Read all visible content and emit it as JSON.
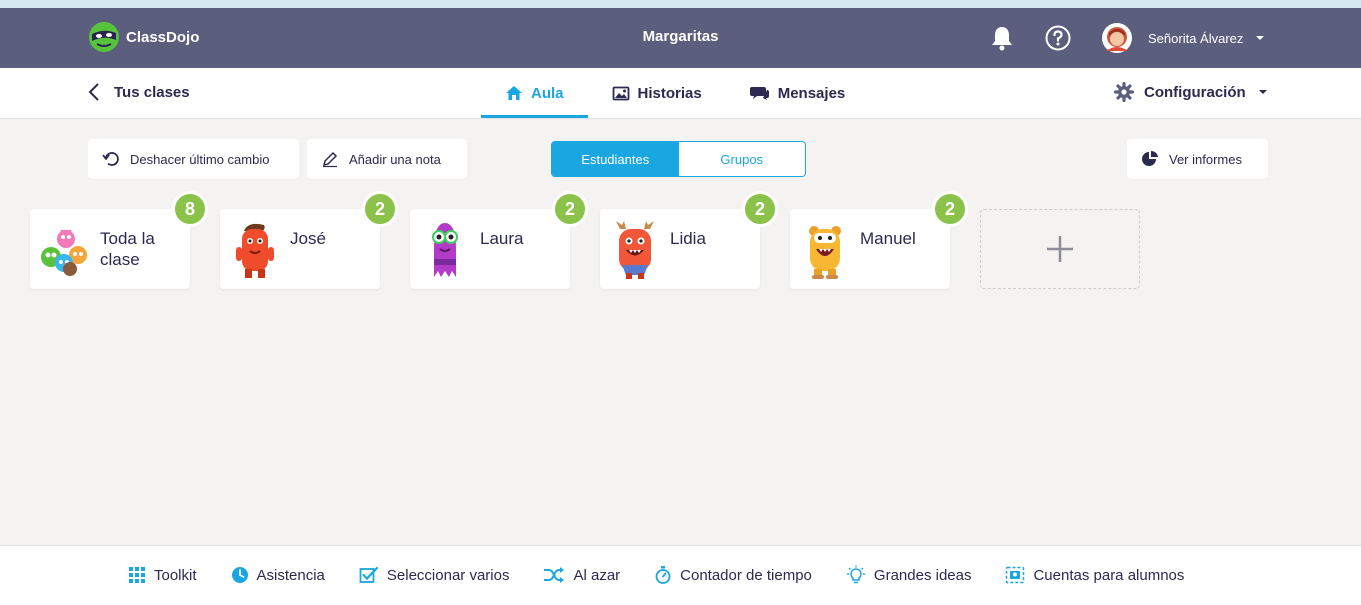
{
  "app": {
    "brand": "ClassDojo",
    "class_name": "Margaritas",
    "user_name": "Señorita Álvarez"
  },
  "subnav": {
    "back_label": "Tus clases",
    "tabs": [
      {
        "label": "Aula",
        "active": true,
        "icon": "home-icon"
      },
      {
        "label": "Historias",
        "active": false,
        "icon": "image-icon"
      },
      {
        "label": "Mensajes",
        "active": false,
        "icon": "chat-icon"
      }
    ],
    "settings_label": "Configuración"
  },
  "toolbar": {
    "undo_label": "Deshacer último cambio",
    "note_label": "Añadir una nota",
    "segment": [
      {
        "label": "Estudiantes",
        "active": true
      },
      {
        "label": "Grupos",
        "active": false
      }
    ],
    "reports_label": "Ver informes"
  },
  "students": [
    {
      "name": "Toda la clase",
      "points": "8"
    },
    {
      "name": "José",
      "points": "2"
    },
    {
      "name": "Laura",
      "points": "2"
    },
    {
      "name": "Lidia",
      "points": "2"
    },
    {
      "name": "Manuel",
      "points": "2"
    }
  ],
  "bottom_bar": [
    {
      "label": "Toolkit",
      "icon": "grid-icon"
    },
    {
      "label": "Asistencia",
      "icon": "clock-icon"
    },
    {
      "label": "Seleccionar varios",
      "icon": "checkbox-icon"
    },
    {
      "label": "Al azar",
      "icon": "shuffle-icon"
    },
    {
      "label": "Contador de tiempo",
      "icon": "stopwatch-icon"
    },
    {
      "label": "Grandes ideas",
      "icon": "lightbulb-icon"
    },
    {
      "label": "Cuentas para alumnos",
      "icon": "student-accounts-icon"
    }
  ],
  "colors": {
    "header": "#5b5e7d",
    "accent": "#1aa6e0",
    "badge": "#8bc34a",
    "background": "#f4f3f1"
  }
}
